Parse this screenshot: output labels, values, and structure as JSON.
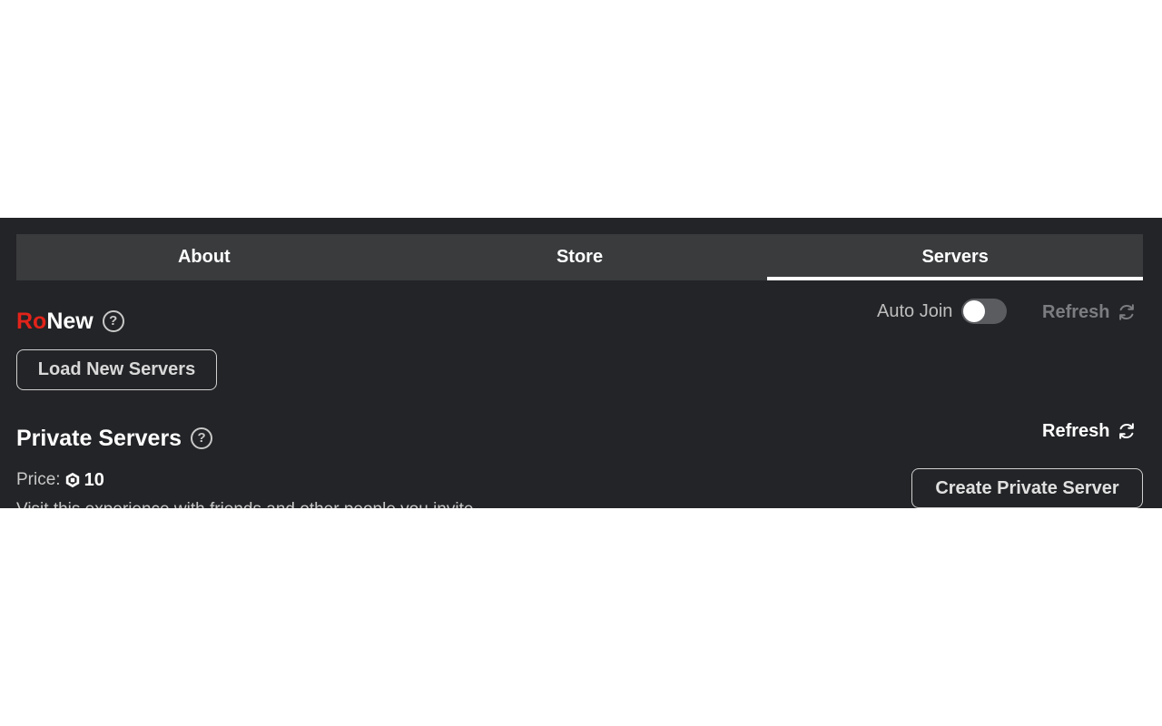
{
  "tabs": [
    {
      "label": "About",
      "active": false
    },
    {
      "label": "Store",
      "active": false
    },
    {
      "label": "Servers",
      "active": true
    }
  ],
  "ronew": {
    "title_red": "Ro",
    "title_white": "New",
    "help_icon": "question-circle-icon",
    "load_button": "Load New Servers"
  },
  "top_controls": {
    "auto_join_label": "Auto Join",
    "auto_join_on": false,
    "refresh_label": "Refresh",
    "refresh_icon": "refresh-icon"
  },
  "private_servers": {
    "title": "Private Servers",
    "help_icon": "question-circle-icon",
    "refresh_label": "Refresh",
    "price_label": "Price:",
    "price_icon": "robux-icon",
    "price_value": "10",
    "create_button": "Create Private Server",
    "description": "Visit this experience with friends and other people you invite."
  },
  "colors": {
    "panel_bg": "#232427",
    "tab_bar_bg": "#393b3d",
    "brand_red": "#e2231a",
    "active_underline": "#ffffff"
  }
}
